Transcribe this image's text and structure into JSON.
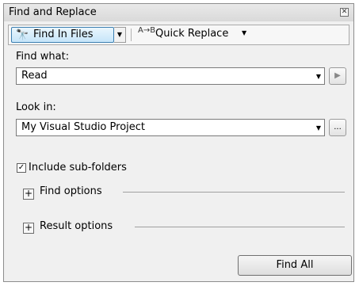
{
  "window": {
    "title": "Find and Replace",
    "close_glyph": "✕"
  },
  "toolbar": {
    "find_in_files": {
      "label": "Find In Files",
      "icon": "binoculars-icon",
      "glyph": "🔭"
    },
    "dropdown_arrow": "▼",
    "quick_replace": {
      "label": "Quick Replace",
      "icon": "replace-icon",
      "glyph": "A→B"
    }
  },
  "find_what": {
    "label": "Find what:",
    "value": "Read",
    "run_glyph": "▶"
  },
  "look_in": {
    "label": "Look in:",
    "value": "My Visual Studio Project",
    "browse_glyph": "..."
  },
  "include_subfolders": {
    "label": "Include sub-folders",
    "checked": true,
    "check_glyph": "✓"
  },
  "find_options": {
    "label": "Find options",
    "expand_glyph": "+"
  },
  "result_options": {
    "label": "Result options",
    "expand_glyph": "+"
  },
  "find_all_button": {
    "label": "Find All"
  }
}
